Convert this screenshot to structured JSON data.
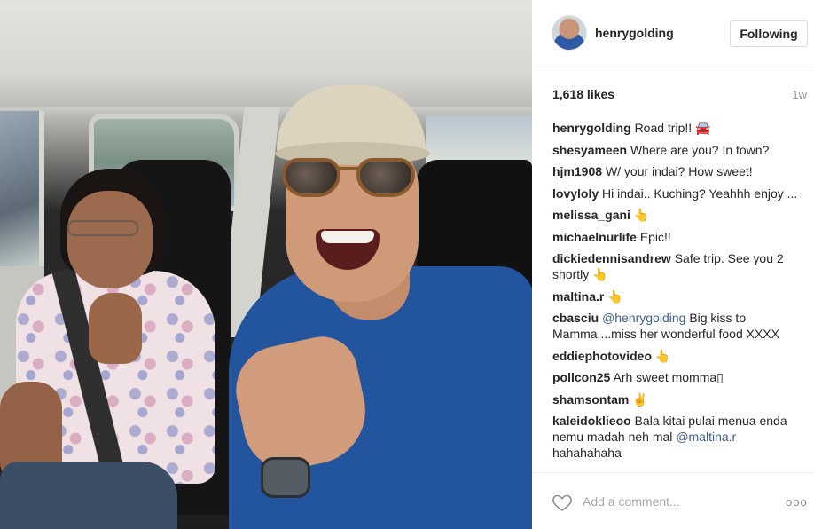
{
  "header": {
    "username": "henrygolding",
    "follow_label": "Following"
  },
  "meta": {
    "likes": "1,618 likes",
    "time": "1w"
  },
  "comments": [
    {
      "user": "henrygolding",
      "text": "Road trip!! 🚘"
    },
    {
      "user": "shesyameen",
      "text": "Where are you? In town?"
    },
    {
      "user": "hjm1908",
      "text": "W/ your indai? How sweet!"
    },
    {
      "user": "lovyloly",
      "text": "Hi indai.. Kuching? Yeahhh enjoy ..."
    },
    {
      "user": "melissa_gani",
      "text": "👆"
    },
    {
      "user": "michaelnurlife",
      "text": "Epic!!"
    },
    {
      "user": "dickiedennisandrew",
      "text": "Safe trip. See you 2 shortly 👆"
    },
    {
      "user": "maltina.r",
      "text": "👆"
    },
    {
      "user": "cbasciu",
      "mention": "@henrygolding",
      "text": "Big kiss to Mamma....miss her wonderful food XXXX"
    },
    {
      "user": "eddiephotovideo",
      "text": "👆"
    },
    {
      "user": "pollcon25",
      "text": "Arh sweet momma▯"
    },
    {
      "user": "shamsontam",
      "text": "✌"
    },
    {
      "user": "kaleidoklieoo",
      "text": "Bala kitai pulai menua enda nemu madah neh mal",
      "mention_after": "@maltina.r",
      "text_after": "hahahahaha"
    }
  ],
  "footer": {
    "comment_placeholder": "Add a comment...",
    "more_label": "ooo"
  },
  "icons": {
    "like": "heart-icon",
    "more": "more-options-icon",
    "avatar": "profile-avatar"
  },
  "colors": {
    "mention": "#3d5f8a",
    "border": "#efefef",
    "muted": "#999999",
    "jersey": "#23559e"
  }
}
